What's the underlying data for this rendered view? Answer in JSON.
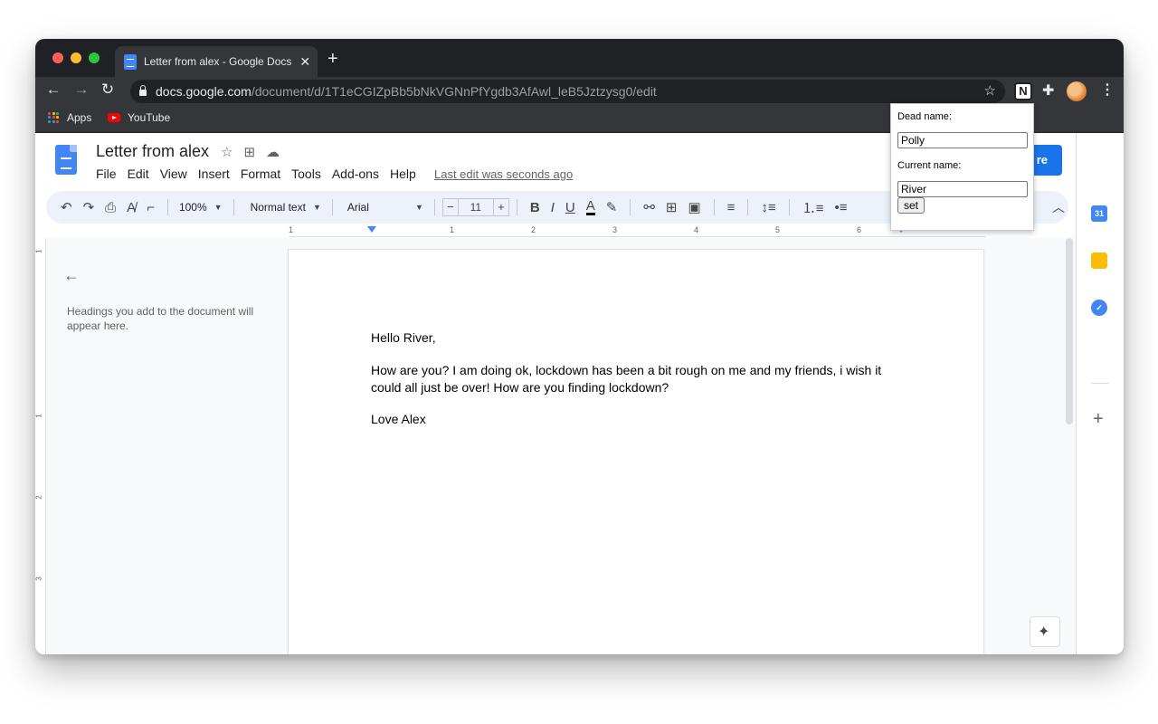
{
  "browser": {
    "tab_title": "Letter from alex - Google Docs",
    "new_tab": "+",
    "url_host": "docs.google.com",
    "url_path": "/document/d/1T1eCGIZpBb5bNkVGNnPfYgdb3AfAwl_leB5Jztzysg0/edit",
    "extension_letter": "N",
    "bookmarks": [
      "Apps",
      "YouTube"
    ]
  },
  "docs": {
    "title": "Letter from alex",
    "menu": [
      "File",
      "Edit",
      "View",
      "Insert",
      "Format",
      "Tools",
      "Add-ons",
      "Help"
    ],
    "last_edit": "Last edit was seconds ago",
    "share_label": "re"
  },
  "toolbar": {
    "zoom": "100%",
    "style": "Normal text",
    "font": "Arial",
    "font_size": "11",
    "minus": "−",
    "plus": "+"
  },
  "ruler": [
    "1",
    "1",
    "2",
    "3",
    "4",
    "5",
    "6"
  ],
  "vruler": [
    "1",
    "1",
    "2",
    "3"
  ],
  "outline": {
    "placeholder": "Headings you add to the document will appear here."
  },
  "document": {
    "greeting": "Hello River,",
    "body": "How are you? I am doing ok, lockdown has been a bit rough on me and my friends, i wish it could all just be over! How are you finding lockdown?",
    "signoff": "Love Alex"
  },
  "popup": {
    "dead_name_label": "Dead name:",
    "dead_name_value": "Polly",
    "current_name_label": "Current name:",
    "current_name_value": "River",
    "set_label": "set"
  },
  "side_panel": {
    "calendar_day": "31"
  },
  "colors": {
    "accent": "#1a73e8",
    "chrome_dark": "#202124",
    "chrome_tab": "#35363a"
  }
}
